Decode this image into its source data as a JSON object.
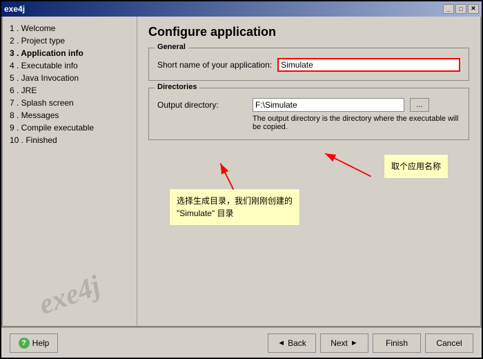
{
  "window": {
    "title": "exe4j"
  },
  "titlebar": {
    "buttons": [
      "_",
      "□",
      "✕"
    ]
  },
  "sidebar": {
    "items": [
      {
        "id": "welcome",
        "label": "1 . Welcome",
        "active": false
      },
      {
        "id": "project-type",
        "label": "2 . Project type",
        "active": false
      },
      {
        "id": "application-info",
        "label": "3 . Application info",
        "active": true
      },
      {
        "id": "executable-info",
        "label": "4 . Executable info",
        "active": false
      },
      {
        "id": "java-invocation",
        "label": "5 . Java Invocation",
        "active": false
      },
      {
        "id": "jre",
        "label": "6 . JRE",
        "active": false
      },
      {
        "id": "splash-screen",
        "label": "7 . Splash screen",
        "active": false
      },
      {
        "id": "messages",
        "label": "8 . Messages",
        "active": false
      },
      {
        "id": "compile-executable",
        "label": "9 . Compile executable",
        "active": false
      },
      {
        "id": "finished",
        "label": "10 . Finished",
        "active": false
      }
    ],
    "watermark": "exe4j"
  },
  "content": {
    "title": "Configure application",
    "general_group": {
      "legend": "General",
      "short_name_label": "Short name of your application:",
      "short_name_value": "Simulate"
    },
    "directories_group": {
      "legend": "Directories",
      "output_label": "Output directory:",
      "output_value": "F:\\Simulate",
      "browse_label": "...",
      "hint": "The output directory is the directory where the executable will be copied."
    },
    "callout_left": {
      "line1": "选择生成目录，我们刚刚创建的",
      "line2": "“Simulate” 目录"
    },
    "callout_right": {
      "text": "取个应用名称"
    }
  },
  "footer": {
    "help_label": "Help",
    "back_label": "Back",
    "next_label": "Next",
    "finish_label": "Finish",
    "cancel_label": "Cancel"
  }
}
